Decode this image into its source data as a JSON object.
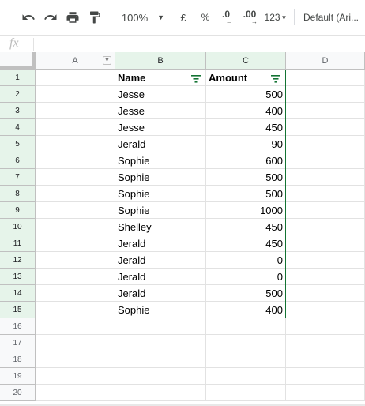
{
  "toolbar": {
    "items": [
      {
        "icon": "undo-icon"
      },
      {
        "icon": "redo-icon"
      },
      {
        "icon": "print-icon"
      },
      {
        "icon": "paint-format-icon"
      }
    ],
    "zoom": "100%",
    "currency": "£",
    "percent": "%",
    "decrease_decimal": ".0",
    "increase_decimal": ".00",
    "more_formats": "123",
    "font": "Default (Ari..."
  },
  "formula_bar": {
    "fx_label": "fx",
    "value": ""
  },
  "columns": [
    "A",
    "B",
    "C",
    "D"
  ],
  "rows": [
    "1",
    "2",
    "3",
    "4",
    "5",
    "6",
    "7",
    "8",
    "9",
    "10",
    "11",
    "12",
    "13",
    "14",
    "15",
    "16",
    "17",
    "18",
    "19",
    "20"
  ],
  "table": {
    "headers": {
      "name": "Name",
      "amount": "Amount"
    },
    "data": [
      {
        "name": "Jesse",
        "amount": "500"
      },
      {
        "name": "Jesse",
        "amount": "400"
      },
      {
        "name": "Jesse",
        "amount": "450"
      },
      {
        "name": "Jerald",
        "amount": "90"
      },
      {
        "name": "Sophie",
        "amount": "600"
      },
      {
        "name": "Sophie",
        "amount": "500"
      },
      {
        "name": "Sophie",
        "amount": "500"
      },
      {
        "name": "Sophie",
        "amount": "1000"
      },
      {
        "name": "Shelley",
        "amount": "450"
      },
      {
        "name": "Jerald",
        "amount": "450"
      },
      {
        "name": "Jerald",
        "amount": "0"
      },
      {
        "name": "Jerald",
        "amount": "0"
      },
      {
        "name": "Jerald",
        "amount": "500"
      },
      {
        "name": "Sophie",
        "amount": "400"
      }
    ]
  },
  "colors": {
    "selection": "#137333",
    "selected_header": "#e6f4ea"
  }
}
